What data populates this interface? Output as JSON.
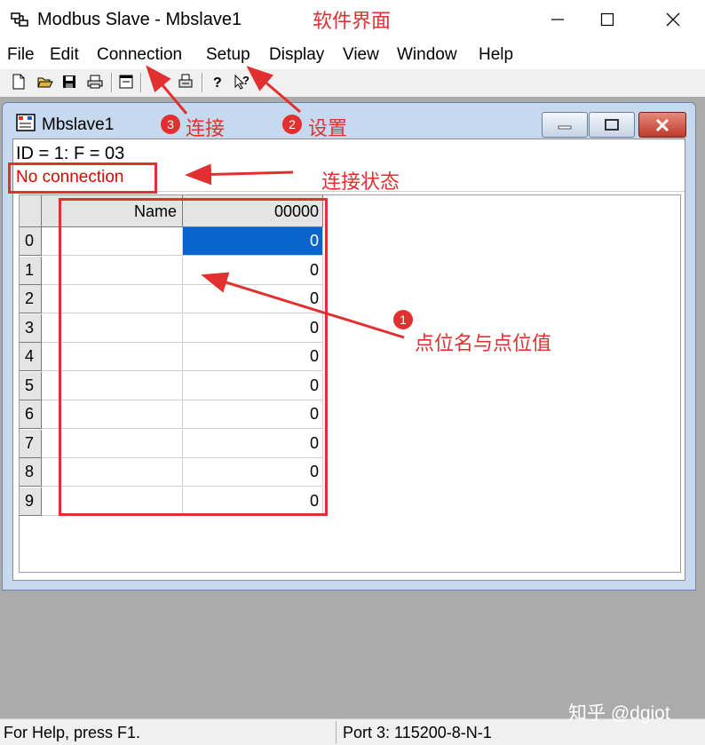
{
  "window": {
    "title": "Modbus Slave - Mbslave1"
  },
  "menu": [
    "File",
    "Edit",
    "Connection",
    "Setup",
    "Display",
    "View",
    "Window",
    "Help"
  ],
  "toolbar_icons": [
    "new-icon",
    "open-icon",
    "save-icon",
    "print-icon",
    "window-icon",
    "read-icon",
    "print-preview-icon",
    "help-icon",
    "context-help-icon"
  ],
  "child": {
    "title": "Mbslave1",
    "id_line": "ID = 1: F = 03",
    "connection_status": "No connection",
    "grid": {
      "name_header": "Name",
      "value_header": "00000",
      "rows": [
        {
          "index": "0",
          "name": "",
          "value": "0"
        },
        {
          "index": "1",
          "name": "",
          "value": "0"
        },
        {
          "index": "2",
          "name": "",
          "value": "0"
        },
        {
          "index": "3",
          "name": "",
          "value": "0"
        },
        {
          "index": "4",
          "name": "",
          "value": "0"
        },
        {
          "index": "5",
          "name": "",
          "value": "0"
        },
        {
          "index": "6",
          "name": "",
          "value": "0"
        },
        {
          "index": "7",
          "name": "",
          "value": "0"
        },
        {
          "index": "8",
          "name": "",
          "value": "0"
        },
        {
          "index": "9",
          "name": "",
          "value": "0"
        }
      ]
    }
  },
  "annotations": {
    "software_ui": "软件界面",
    "connect": "连接",
    "setup": "设置",
    "connection_state": "连接状态",
    "points": "点位名与点位值",
    "badge_1": "1",
    "badge_2": "2",
    "badge_3": "3"
  },
  "statusbar": {
    "help": "For Help, press F1.",
    "port": "Port 3: 115200-8-N-1"
  },
  "watermark": "知乎 @dgiot",
  "colors": {
    "annotation": "#e23030",
    "selection": "#0a64cc",
    "status_text": "#e00000"
  }
}
